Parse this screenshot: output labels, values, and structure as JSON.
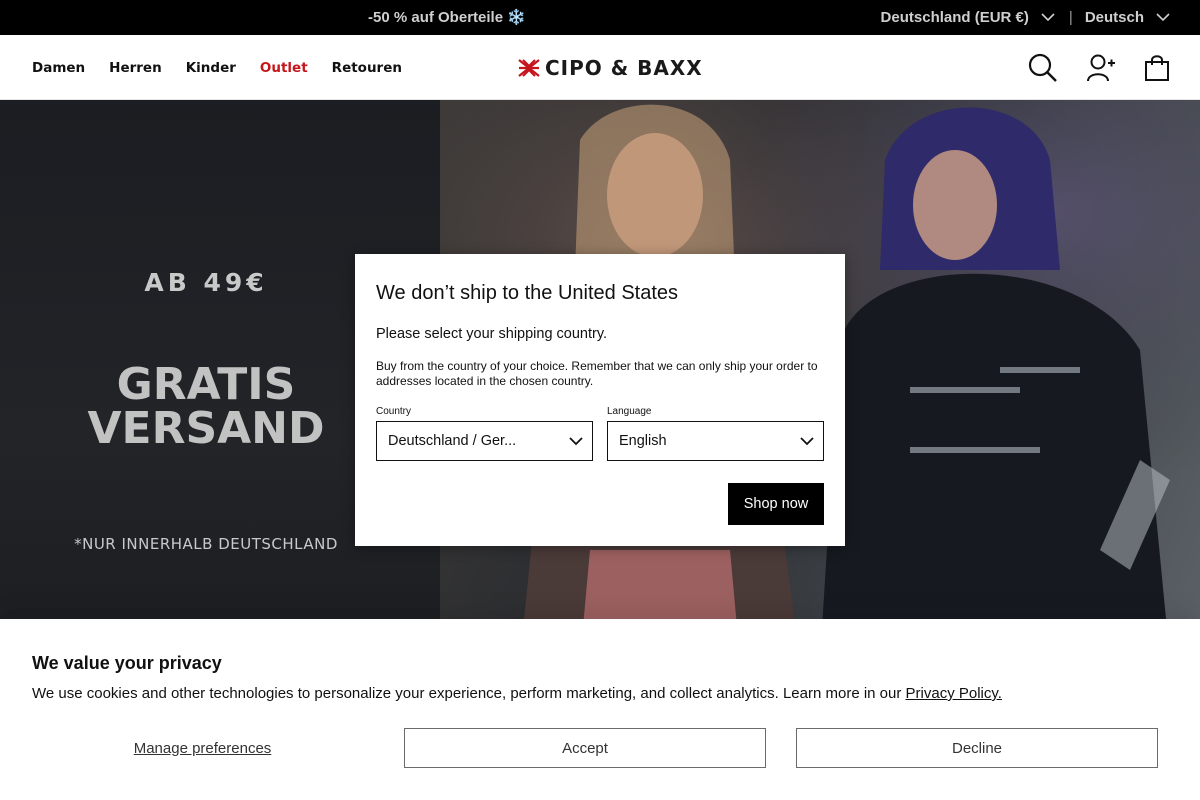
{
  "topbar": {
    "promo": "-50 % auf Oberteile ❄️",
    "country_selector": "Deutschland (EUR €)",
    "separator": "|",
    "language_selector": "Deutsch"
  },
  "header": {
    "nav": [
      {
        "label": "Damen"
      },
      {
        "label": "Herren"
      },
      {
        "label": "Kinder"
      },
      {
        "label": "Outlet",
        "highlight": "#c4161c"
      },
      {
        "label": "Retouren"
      }
    ],
    "logo_text": "CIPO & BAXX",
    "icons": [
      "search-icon",
      "account-add-icon",
      "shopping-bag-icon"
    ]
  },
  "hero": {
    "line1": "AB 49€",
    "line2a": "GRATIS",
    "line2b": "VERSAND",
    "line3": "*NUR INNERHALB DEUTSCHLAND"
  },
  "modal": {
    "title": "We don’t ship to the United States",
    "subtitle": "Please select your shipping country.",
    "info": "Buy from the country of your choice. Remember that we can only ship your order to addresses located in the chosen country.",
    "country_label": "Country",
    "country_value": "Deutschland / Ger...",
    "language_label": "Language",
    "language_value": "English",
    "button": "Shop now"
  },
  "cookie": {
    "title": "We value your privacy",
    "text": "We use cookies and other technologies to personalize your experience, perform marketing, and collect analytics. Learn more in our ",
    "policy_link": "Privacy Policy.",
    "manage": "Manage preferences",
    "accept": "Accept",
    "decline": "Decline"
  },
  "colors": {
    "accent_outlet": "#c4161c",
    "topbar_bg": "#000000",
    "button_bg": "#000000"
  }
}
